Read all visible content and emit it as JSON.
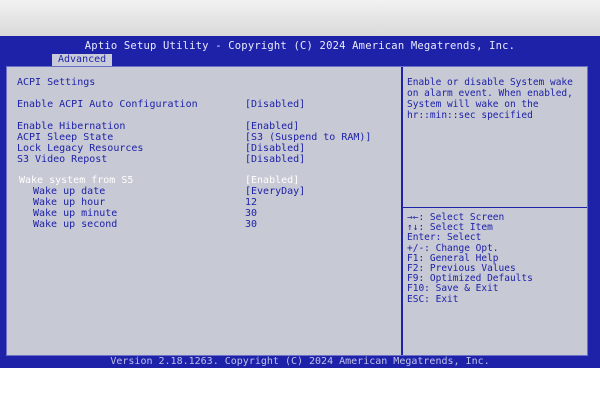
{
  "header": {
    "title": "Aptio Setup Utility - Copyright (C) 2024 American Megatrends, Inc.",
    "tabs": [
      {
        "label": "Advanced"
      }
    ]
  },
  "settings": {
    "section_title": "ACPI Settings",
    "items": [
      {
        "label": "Enable ACPI Auto Configuration",
        "value": "[Disabled]"
      },
      {
        "label": "Enable Hibernation",
        "value": "[Enabled]"
      },
      {
        "label": "ACPI Sleep State",
        "value": "[S3 (Suspend to RAM)]"
      },
      {
        "label": "Lock Legacy Resources",
        "value": "[Disabled]"
      },
      {
        "label": "S3 Video Repost",
        "value": "[Disabled]"
      },
      {
        "label": "Wake system from S5",
        "value": "[Enabled]",
        "selected": true
      },
      {
        "label": "Wake up date",
        "value": "[EveryDay]"
      },
      {
        "label": "Wake up hour",
        "value": "12"
      },
      {
        "label": "Wake up minute",
        "value": "30"
      },
      {
        "label": "Wake up second",
        "value": "30"
      }
    ]
  },
  "help": {
    "text": "Enable or disable System wake on alarm event. When enabled, System will wake on the hr::min::sec specified",
    "keys": [
      "→←: Select Screen",
      "↑↓: Select Item",
      "Enter: Select",
      "+/-: Change Opt.",
      "F1: General Help",
      "F2: Previous Values",
      "F9: Optimized Defaults",
      "F10: Save & Exit",
      "ESC: Exit"
    ]
  },
  "footer": {
    "version": "Version 2.18.1263. Copyright (C) 2024 American Megatrends, Inc."
  },
  "colors": {
    "bios_blue": "#1e22a8",
    "panel_gray": "#c7c9d4",
    "highlight": "#ffffff"
  }
}
